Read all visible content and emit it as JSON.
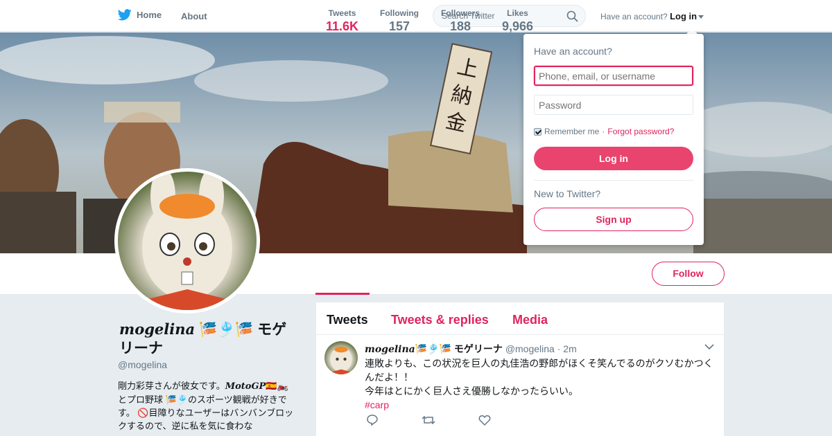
{
  "nav": {
    "home_label": "Home",
    "about_label": "About",
    "search_placeholder": "Search Twitter",
    "have_account": "Have an account?",
    "login_label": "Log in"
  },
  "profile": {
    "display_name_script": "mogelina",
    "display_name_emoji": "🎏🎐🎏",
    "display_name_jp": "モゲリーナ",
    "handle": "@mogelina",
    "bio_line1": "剛力彩芽さんが彼女です。",
    "bio_motogp": "MotoGP",
    "bio_line1_emoji": "🇪🇸🏍️",
    "bio_line2": "とプロ野球 ",
    "bio_line2_emoji": "🎏🎐",
    "bio_line2_rest": "のスポーツ観戦が好きです。",
    "bio_line3_emoji": "🚫",
    "bio_line3": "目障りなユーザーはバンバンブロックするので、逆に私を気に食わな"
  },
  "stats": [
    {
      "label": "Tweets",
      "value": "11.6K"
    },
    {
      "label": "Following",
      "value": "157"
    },
    {
      "label": "Followers",
      "value": "188"
    },
    {
      "label": "Likes",
      "value": "9,966"
    }
  ],
  "follow_label": "Follow",
  "timeline": {
    "tabs": [
      "Tweets",
      "Tweets & replies",
      "Media"
    ],
    "tweet": {
      "name_script": "mogelina",
      "name_emoji": "🎏🎐🎏",
      "name_jp": "モゲリーナ",
      "handle": "@mogelina",
      "time": "2m",
      "text_line1": "連敗よりも、この状況を巨人の丸佳浩の野郎がほくそ笑んでるのがクソむかつくんだよ！！",
      "text_line2": "今年はとにかく巨人さえ優勝しなかったらいい。",
      "hashtag": "#carp"
    }
  },
  "login_dropdown": {
    "title": "Have an account?",
    "username_placeholder": "Phone, email, or username",
    "password_placeholder": "Password",
    "remember_label": "Remember me",
    "separator": " · ",
    "forgot_label": "Forgot password?",
    "login_button": "Log in",
    "new_label": "New to Twitter?",
    "signup_button": "Sign up"
  },
  "colors": {
    "accent": "#e0245e",
    "twitter_blue": "#1da1f2",
    "text_secondary": "#657786"
  }
}
